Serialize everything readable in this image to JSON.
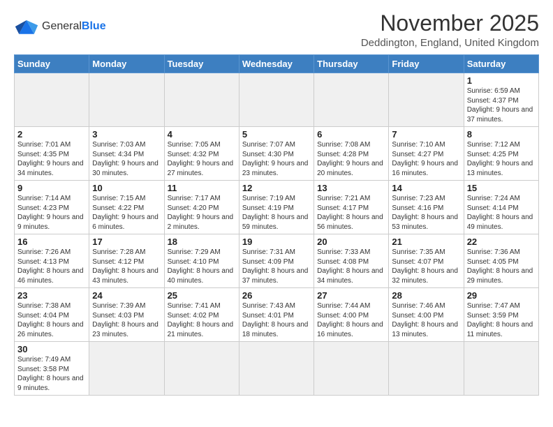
{
  "header": {
    "logo_general": "General",
    "logo_blue": "Blue",
    "month_title": "November 2025",
    "location": "Deddington, England, United Kingdom"
  },
  "weekdays": [
    "Sunday",
    "Monday",
    "Tuesday",
    "Wednesday",
    "Thursday",
    "Friday",
    "Saturday"
  ],
  "weeks": [
    [
      {
        "day": "",
        "info": ""
      },
      {
        "day": "",
        "info": ""
      },
      {
        "day": "",
        "info": ""
      },
      {
        "day": "",
        "info": ""
      },
      {
        "day": "",
        "info": ""
      },
      {
        "day": "",
        "info": ""
      },
      {
        "day": "1",
        "info": "Sunrise: 6:59 AM\nSunset: 4:37 PM\nDaylight: 9 hours\nand 37 minutes."
      }
    ],
    [
      {
        "day": "2",
        "info": "Sunrise: 7:01 AM\nSunset: 4:35 PM\nDaylight: 9 hours\nand 34 minutes."
      },
      {
        "day": "3",
        "info": "Sunrise: 7:03 AM\nSunset: 4:34 PM\nDaylight: 9 hours\nand 30 minutes."
      },
      {
        "day": "4",
        "info": "Sunrise: 7:05 AM\nSunset: 4:32 PM\nDaylight: 9 hours\nand 27 minutes."
      },
      {
        "day": "5",
        "info": "Sunrise: 7:07 AM\nSunset: 4:30 PM\nDaylight: 9 hours\nand 23 minutes."
      },
      {
        "day": "6",
        "info": "Sunrise: 7:08 AM\nSunset: 4:28 PM\nDaylight: 9 hours\nand 20 minutes."
      },
      {
        "day": "7",
        "info": "Sunrise: 7:10 AM\nSunset: 4:27 PM\nDaylight: 9 hours\nand 16 minutes."
      },
      {
        "day": "8",
        "info": "Sunrise: 7:12 AM\nSunset: 4:25 PM\nDaylight: 9 hours\nand 13 minutes."
      }
    ],
    [
      {
        "day": "9",
        "info": "Sunrise: 7:14 AM\nSunset: 4:23 PM\nDaylight: 9 hours\nand 9 minutes."
      },
      {
        "day": "10",
        "info": "Sunrise: 7:15 AM\nSunset: 4:22 PM\nDaylight: 9 hours\nand 6 minutes."
      },
      {
        "day": "11",
        "info": "Sunrise: 7:17 AM\nSunset: 4:20 PM\nDaylight: 9 hours\nand 2 minutes."
      },
      {
        "day": "12",
        "info": "Sunrise: 7:19 AM\nSunset: 4:19 PM\nDaylight: 8 hours\nand 59 minutes."
      },
      {
        "day": "13",
        "info": "Sunrise: 7:21 AM\nSunset: 4:17 PM\nDaylight: 8 hours\nand 56 minutes."
      },
      {
        "day": "14",
        "info": "Sunrise: 7:23 AM\nSunset: 4:16 PM\nDaylight: 8 hours\nand 53 minutes."
      },
      {
        "day": "15",
        "info": "Sunrise: 7:24 AM\nSunset: 4:14 PM\nDaylight: 8 hours\nand 49 minutes."
      }
    ],
    [
      {
        "day": "16",
        "info": "Sunrise: 7:26 AM\nSunset: 4:13 PM\nDaylight: 8 hours\nand 46 minutes."
      },
      {
        "day": "17",
        "info": "Sunrise: 7:28 AM\nSunset: 4:12 PM\nDaylight: 8 hours\nand 43 minutes."
      },
      {
        "day": "18",
        "info": "Sunrise: 7:29 AM\nSunset: 4:10 PM\nDaylight: 8 hours\nand 40 minutes."
      },
      {
        "day": "19",
        "info": "Sunrise: 7:31 AM\nSunset: 4:09 PM\nDaylight: 8 hours\nand 37 minutes."
      },
      {
        "day": "20",
        "info": "Sunrise: 7:33 AM\nSunset: 4:08 PM\nDaylight: 8 hours\nand 34 minutes."
      },
      {
        "day": "21",
        "info": "Sunrise: 7:35 AM\nSunset: 4:07 PM\nDaylight: 8 hours\nand 32 minutes."
      },
      {
        "day": "22",
        "info": "Sunrise: 7:36 AM\nSunset: 4:05 PM\nDaylight: 8 hours\nand 29 minutes."
      }
    ],
    [
      {
        "day": "23",
        "info": "Sunrise: 7:38 AM\nSunset: 4:04 PM\nDaylight: 8 hours\nand 26 minutes."
      },
      {
        "day": "24",
        "info": "Sunrise: 7:39 AM\nSunset: 4:03 PM\nDaylight: 8 hours\nand 23 minutes."
      },
      {
        "day": "25",
        "info": "Sunrise: 7:41 AM\nSunset: 4:02 PM\nDaylight: 8 hours\nand 21 minutes."
      },
      {
        "day": "26",
        "info": "Sunrise: 7:43 AM\nSunset: 4:01 PM\nDaylight: 8 hours\nand 18 minutes."
      },
      {
        "day": "27",
        "info": "Sunrise: 7:44 AM\nSunset: 4:00 PM\nDaylight: 8 hours\nand 16 minutes."
      },
      {
        "day": "28",
        "info": "Sunrise: 7:46 AM\nSunset: 4:00 PM\nDaylight: 8 hours\nand 13 minutes."
      },
      {
        "day": "29",
        "info": "Sunrise: 7:47 AM\nSunset: 3:59 PM\nDaylight: 8 hours\nand 11 minutes."
      }
    ],
    [
      {
        "day": "30",
        "info": "Sunrise: 7:49 AM\nSunset: 3:58 PM\nDaylight: 8 hours\nand 9 minutes."
      },
      {
        "day": "",
        "info": ""
      },
      {
        "day": "",
        "info": ""
      },
      {
        "day": "",
        "info": ""
      },
      {
        "day": "",
        "info": ""
      },
      {
        "day": "",
        "info": ""
      },
      {
        "day": "",
        "info": ""
      }
    ]
  ]
}
